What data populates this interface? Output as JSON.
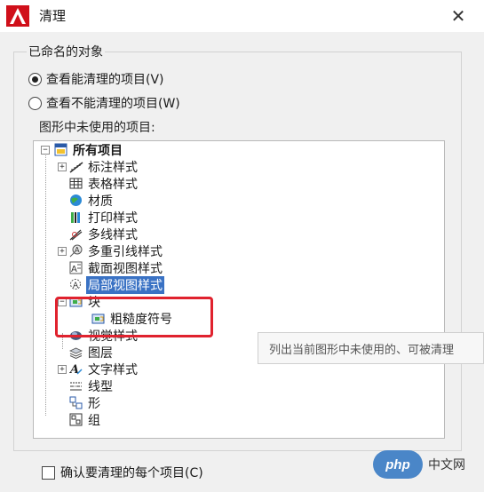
{
  "window": {
    "title": "清理"
  },
  "group": {
    "label": "已命名的对象",
    "radios": [
      {
        "label": "查看能清理的项目(V)",
        "checked": true
      },
      {
        "label": "查看不能清理的项目(W)",
        "checked": false
      }
    ],
    "tree_caption": "图形中未使用的项目:"
  },
  "tree": {
    "root": "所有项目",
    "items": [
      {
        "label": "标注样式",
        "icon": "dimension-style-icon"
      },
      {
        "label": "表格样式",
        "icon": "table-style-icon"
      },
      {
        "label": "材质",
        "icon": "material-icon"
      },
      {
        "label": "打印样式",
        "icon": "plot-style-icon"
      },
      {
        "label": "多线样式",
        "icon": "multiline-style-icon"
      },
      {
        "label": "多重引线样式",
        "icon": "multileader-style-icon"
      },
      {
        "label": "截面视图样式",
        "icon": "section-view-icon"
      },
      {
        "label": "局部视图样式",
        "icon": "detail-view-icon"
      },
      {
        "label": "块",
        "icon": "block-icon"
      },
      {
        "label": "粗糙度符号",
        "icon": "block-item-icon"
      },
      {
        "label": "视觉样式",
        "icon": "visual-style-icon"
      },
      {
        "label": "图层",
        "icon": "layer-icon"
      },
      {
        "label": "文字样式",
        "icon": "text-style-icon"
      },
      {
        "label": "线型",
        "icon": "linetype-icon"
      },
      {
        "label": "形",
        "icon": "shape-icon"
      },
      {
        "label": "组",
        "icon": "group-icon"
      }
    ]
  },
  "tooltip": "列出当前图形中未使用的、可被清理",
  "confirm_checkbox": {
    "label": "确认要清理的每个项目(C)",
    "checked": false
  },
  "watermark": {
    "logo": "php",
    "text": "中文网"
  },
  "colors": {
    "selection": "#3a72c4",
    "highlight": "#e0222e",
    "app_red": "#d0101a"
  }
}
